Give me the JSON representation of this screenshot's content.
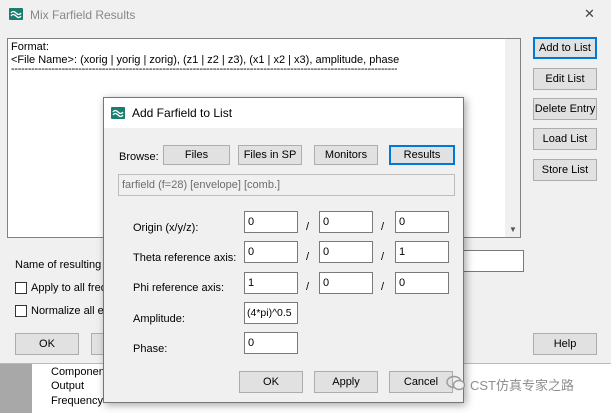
{
  "main_window": {
    "title": "Mix Farfield Results",
    "close_glyph": "✕",
    "format_header": "Format:",
    "format_line": "<File Name>: (xorig | yorig | zorig), (z1 | z2 | z3), (x1 | x2 | x3), amplitude, phase",
    "separator": "------------------------------------------------------------------------------------------------------------------------",
    "side_buttons": {
      "add": "Add to List",
      "edit": "Edit List",
      "delete": "Delete Entry",
      "load": "Load List",
      "store": "Store List"
    },
    "name_label": "Name of resulting f",
    "apply_all": "Apply to all freq",
    "normalize_all": "Normalize all ex",
    "ok": "OK",
    "help": "Help"
  },
  "background_tree": {
    "items": [
      "Componen",
      "Output",
      "Frequency"
    ]
  },
  "dialog": {
    "title": "Add Farfield to List",
    "browse_label": "Browse:",
    "browse_buttons": {
      "files": "Files",
      "files_in_sp": "Files in SP",
      "monitors": "Monitors",
      "results": "Results"
    },
    "selected_path": "farfield (f=28) [envelope] [comb.]",
    "slash": "/",
    "rows": {
      "origin": {
        "label": "Origin (x/y/z):",
        "values": [
          "0",
          "0",
          "0"
        ]
      },
      "theta": {
        "label": "Theta reference axis:",
        "values": [
          "0",
          "0",
          "1"
        ]
      },
      "phi": {
        "label": "Phi reference axis:",
        "values": [
          "1",
          "0",
          "0"
        ]
      }
    },
    "amplitude_label": "Amplitude:",
    "amplitude_value": "(4*pi)^0.5",
    "phase_label": "Phase:",
    "phase_value": "0",
    "ok": "OK",
    "apply": "Apply",
    "cancel": "Cancel"
  },
  "watermark": "CST仿真专家之路"
}
